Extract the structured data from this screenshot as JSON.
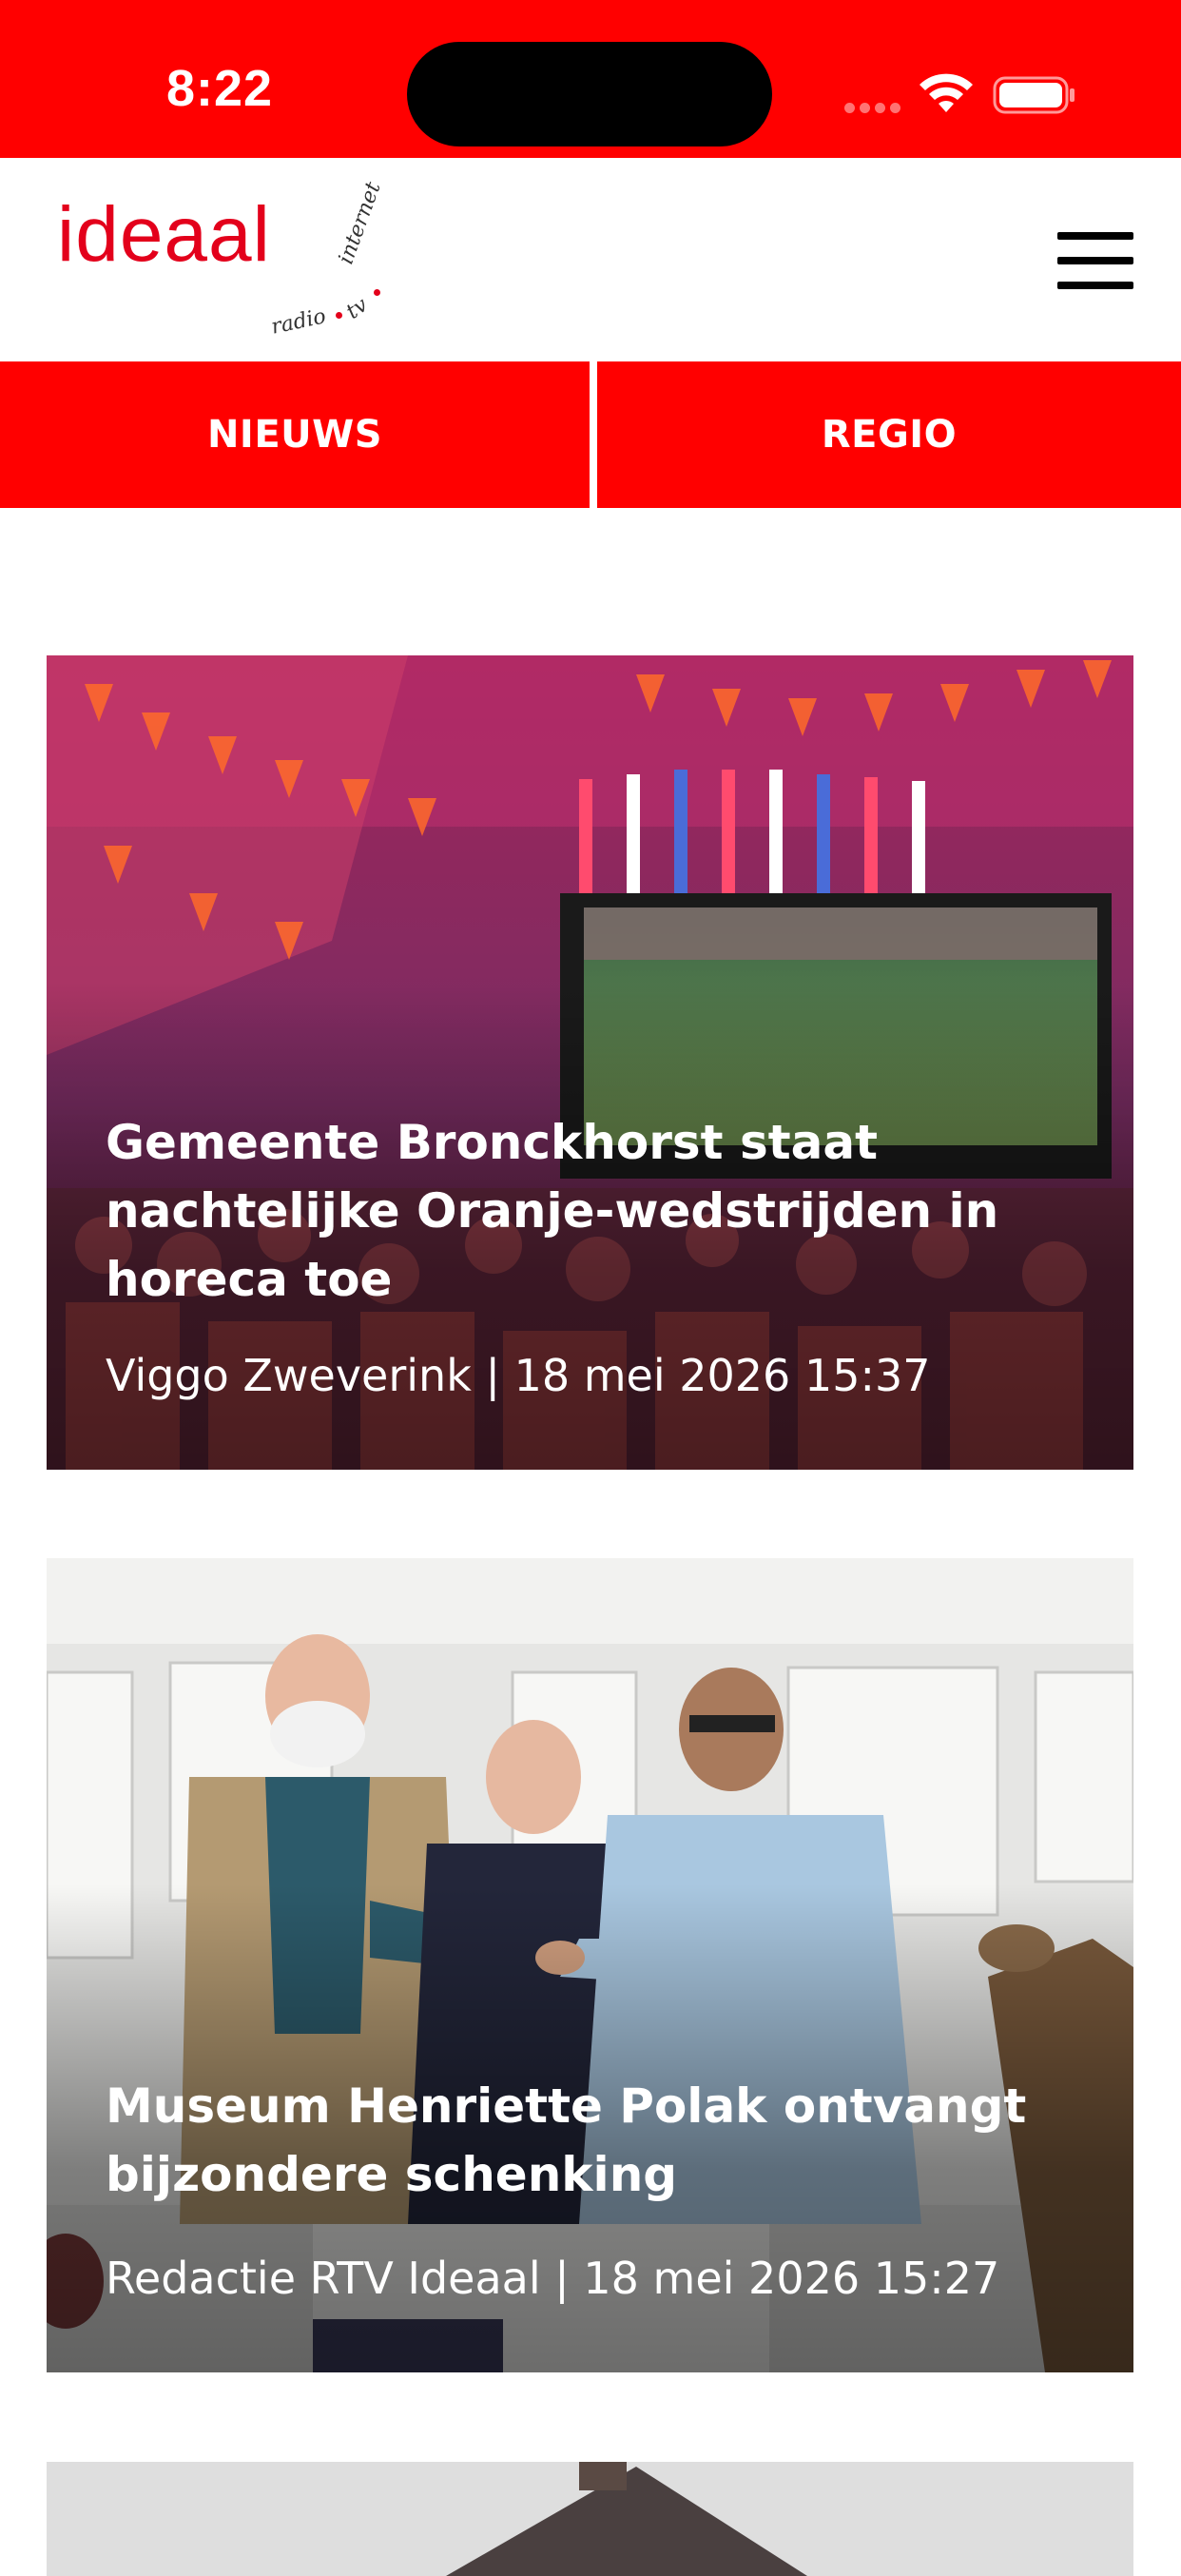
{
  "status_bar": {
    "time": "8:22"
  },
  "header": {
    "logo_text": "ideaal",
    "logo_tagline_radio": "radio",
    "logo_tagline_tv": "tv",
    "logo_tagline_internet": "internet",
    "menu_icon": "hamburger-menu-icon"
  },
  "tabs": [
    {
      "label": "NIEUWS"
    },
    {
      "label": "REGIO"
    }
  ],
  "articles": [
    {
      "title": "Gemeente Bronckhorst staat nachtelijke Oranje-wedstrijden in horeca toe",
      "author": "Viggo Zweverink",
      "date": "18 mei 2026 15:37",
      "meta": "Viggo Zweverink | 18 mei 2026 15:37"
    },
    {
      "title": "Museum Henriette Polak ontvangt bijzondere schenking",
      "author": "Redactie RTV Ideaal",
      "date": "18 mei 2026 15:27",
      "meta": "Redactie RTV Ideaal | 18 mei 2026 15:27"
    }
  ],
  "colors": {
    "brand_red": "#ff0000",
    "logo_red": "#e3001b",
    "text_white": "#ffffff"
  }
}
